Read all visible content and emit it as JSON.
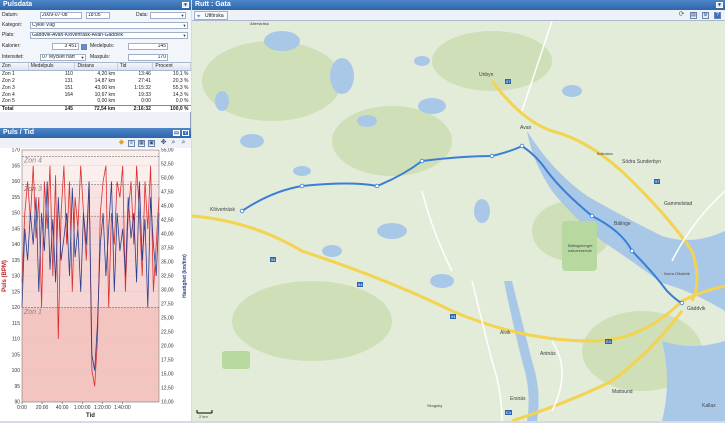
{
  "pulsdata": {
    "title": "Pulsdata",
    "datum_label": "Datum:",
    "datum_value": "2009-07-08",
    "time_value": "18:05",
    "data_label": "Data:",
    "kategori_label": "Kategori:",
    "kategori_value": "Cykel Väg",
    "plats_label": "Plats:",
    "plats_value": "Gäddvik-Avan-Klöverträsk-Avan-Gäddvik",
    "kalorier_label": "Kalorier:",
    "kalorier_value": "3 451",
    "medelpuls_label": "Medelpuls:",
    "medelpuls_value": "145",
    "intensitet_label": "Intensitet:",
    "intensitet_value": "07 Mycket hårt",
    "maxpuls_label": "Maxpuls:",
    "maxpuls_value": "170"
  },
  "zones": {
    "headers": [
      "Zon",
      "Medelpuls",
      "Distans",
      "Tid",
      "Procent"
    ],
    "rows": [
      [
        "Zon 1",
        "110",
        "4,20 km",
        "13:46",
        "10,1 %"
      ],
      [
        "Zon 2",
        "131",
        "14,87 km",
        "27:41",
        "20,3 %"
      ],
      [
        "Zon 3",
        "151",
        "43,00 km",
        "1:15:32",
        "55,3 %"
      ],
      [
        "Zon 4",
        "164",
        "10,67 km",
        "19:33",
        "14,3 %"
      ],
      [
        "Zon 5",
        "",
        "0,00 km",
        "0:00",
        "0,0 %"
      ]
    ],
    "total": [
      "Total",
      "145",
      "72,54 km",
      "2:16:32",
      "100,0 %"
    ]
  },
  "pulstid": {
    "title": "Puls / Tid"
  },
  "chart_data": {
    "type": "line",
    "xlabel": "Tid",
    "ylabel": "Puls (BPM)",
    "y2label": "Hastighet (km/tim)",
    "x_ticks": [
      "0:00",
      "20:00",
      "40:00",
      "1:00:00",
      "1:20:00",
      "1:40:00"
    ],
    "y_ticks": [
      "90",
      "95",
      "100",
      "105",
      "110",
      "115",
      "120",
      "125",
      "130",
      "135",
      "140",
      "145",
      "150",
      "155",
      "160",
      "165",
      "170"
    ],
    "y2_ticks": [
      "10,00",
      "12,50",
      "15,00",
      "17,50",
      "20,00",
      "22,50",
      "25,00",
      "27,50",
      "30,00",
      "32,50",
      "35,00",
      "37,50",
      "40,00",
      "42,50",
      "45,00",
      "47,50",
      "50,00",
      "52,50",
      "55,00"
    ],
    "ylim": [
      90,
      170
    ],
    "y2lim": [
      10,
      55
    ],
    "zone_labels": [
      "Zon 4",
      "Zon 3",
      "Zon 1"
    ],
    "zone_bounds": [
      168,
      159,
      149,
      120
    ],
    "series": [
      {
        "color": "#d83030",
        "values": [
          128,
          150,
          160,
          148,
          165,
          142,
          155,
          120,
          160,
          145,
          165,
          130,
          162,
          110,
          150,
          165,
          140,
          160,
          125,
          155,
          145,
          165,
          150,
          135,
          160,
          100,
          95,
          110,
          150,
          160,
          165,
          120,
          150,
          140,
          160,
          155,
          165,
          125,
          150,
          160,
          140,
          165,
          150,
          130,
          160,
          145,
          165,
          125,
          140,
          155
        ]
      },
      {
        "color": "#2a3f8f",
        "values": [
          120,
          145,
          135,
          150,
          140,
          155,
          125,
          150,
          138,
          160,
          132,
          148,
          128,
          155,
          135,
          142,
          150,
          130,
          158,
          136,
          145,
          125,
          150,
          140,
          160,
          105,
          100,
          115,
          140,
          150,
          130,
          145,
          160,
          125,
          150,
          138,
          145,
          130,
          155,
          142,
          150,
          128,
          160,
          135,
          148,
          120,
          155,
          140,
          130,
          150
        ]
      }
    ]
  },
  "route": {
    "title": "Rutt : Gata",
    "toolbar_label": "Utförska",
    "scale_label": "2 km",
    "places": [
      "Unbyn",
      "Avan",
      "Södra Sunderbyn",
      "Bränslan",
      "Gammelstad",
      "Klöverträsk",
      "Bälinge",
      "Bälingsberget naturreservat",
      "Gäddvik",
      "Norra Gäddvik",
      "Alvik",
      "Antnäs",
      "Ersnäs",
      "Mattsund",
      "Kallax",
      "Altersträsk",
      "Skogsby"
    ],
    "road_numbers": [
      "97",
      "97",
      "94",
      "94",
      "94",
      "E4",
      "E4"
    ],
    "colors": {
      "route": "#3a7fd5",
      "water": "#a9c8e8",
      "land": "#e3ebd9",
      "forest": "#cfdfb8",
      "road_major": "#f3d34f",
      "road_minor": "#ffffff"
    }
  }
}
